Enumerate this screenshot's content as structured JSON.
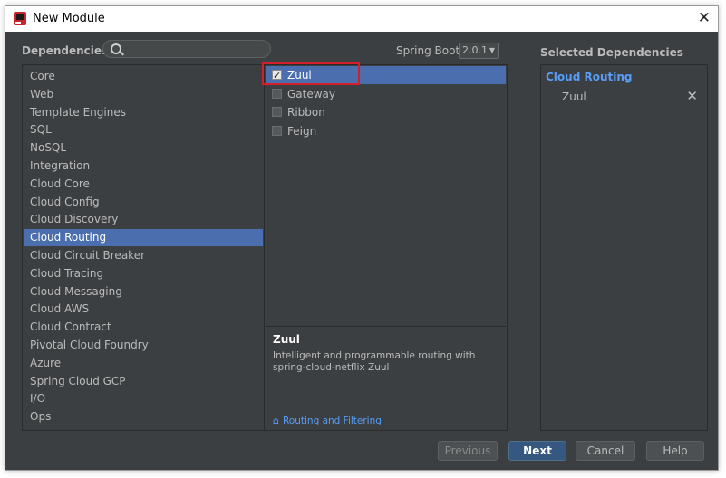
{
  "window": {
    "title": "New Module"
  },
  "header": {
    "dependencies_label": "Dependencies",
    "search": {
      "value": "",
      "placeholder": ""
    },
    "spring_boot_label": "Spring Boot",
    "spring_boot_version": "2.0.1",
    "selected_label": "Selected Dependencies"
  },
  "categories": [
    "Core",
    "Web",
    "Template Engines",
    "SQL",
    "NoSQL",
    "Integration",
    "Cloud Core",
    "Cloud Config",
    "Cloud Discovery",
    "Cloud Routing",
    "Cloud Circuit Breaker",
    "Cloud Tracing",
    "Cloud Messaging",
    "Cloud AWS",
    "Cloud Contract",
    "Pivotal Cloud Foundry",
    "Azure",
    "Spring Cloud GCP",
    "I/O",
    "Ops"
  ],
  "selected_category": "Cloud Routing",
  "dependencies": [
    {
      "label": "Zuul",
      "checked": true,
      "selected": true
    },
    {
      "label": "Gateway",
      "checked": false,
      "selected": false
    },
    {
      "label": "Ribbon",
      "checked": false,
      "selected": false
    },
    {
      "label": "Feign",
      "checked": false,
      "selected": false
    }
  ],
  "description": {
    "title": "Zuul",
    "text": "Intelligent and programmable routing with spring-cloud-netflix Zuul",
    "link_icon": "home-icon",
    "link": "Routing and Filtering"
  },
  "selected_dependencies": {
    "group": "Cloud Routing",
    "items": [
      {
        "label": "Zuul",
        "remove": "✕"
      }
    ]
  },
  "buttons": {
    "previous": "Previous",
    "next": "Next",
    "cancel": "Cancel",
    "help": "Help"
  },
  "colors": {
    "background": "#3c3f41",
    "selection": "#4b6eaf",
    "link": "#589df6",
    "highlight_box": "#d21f2b"
  }
}
